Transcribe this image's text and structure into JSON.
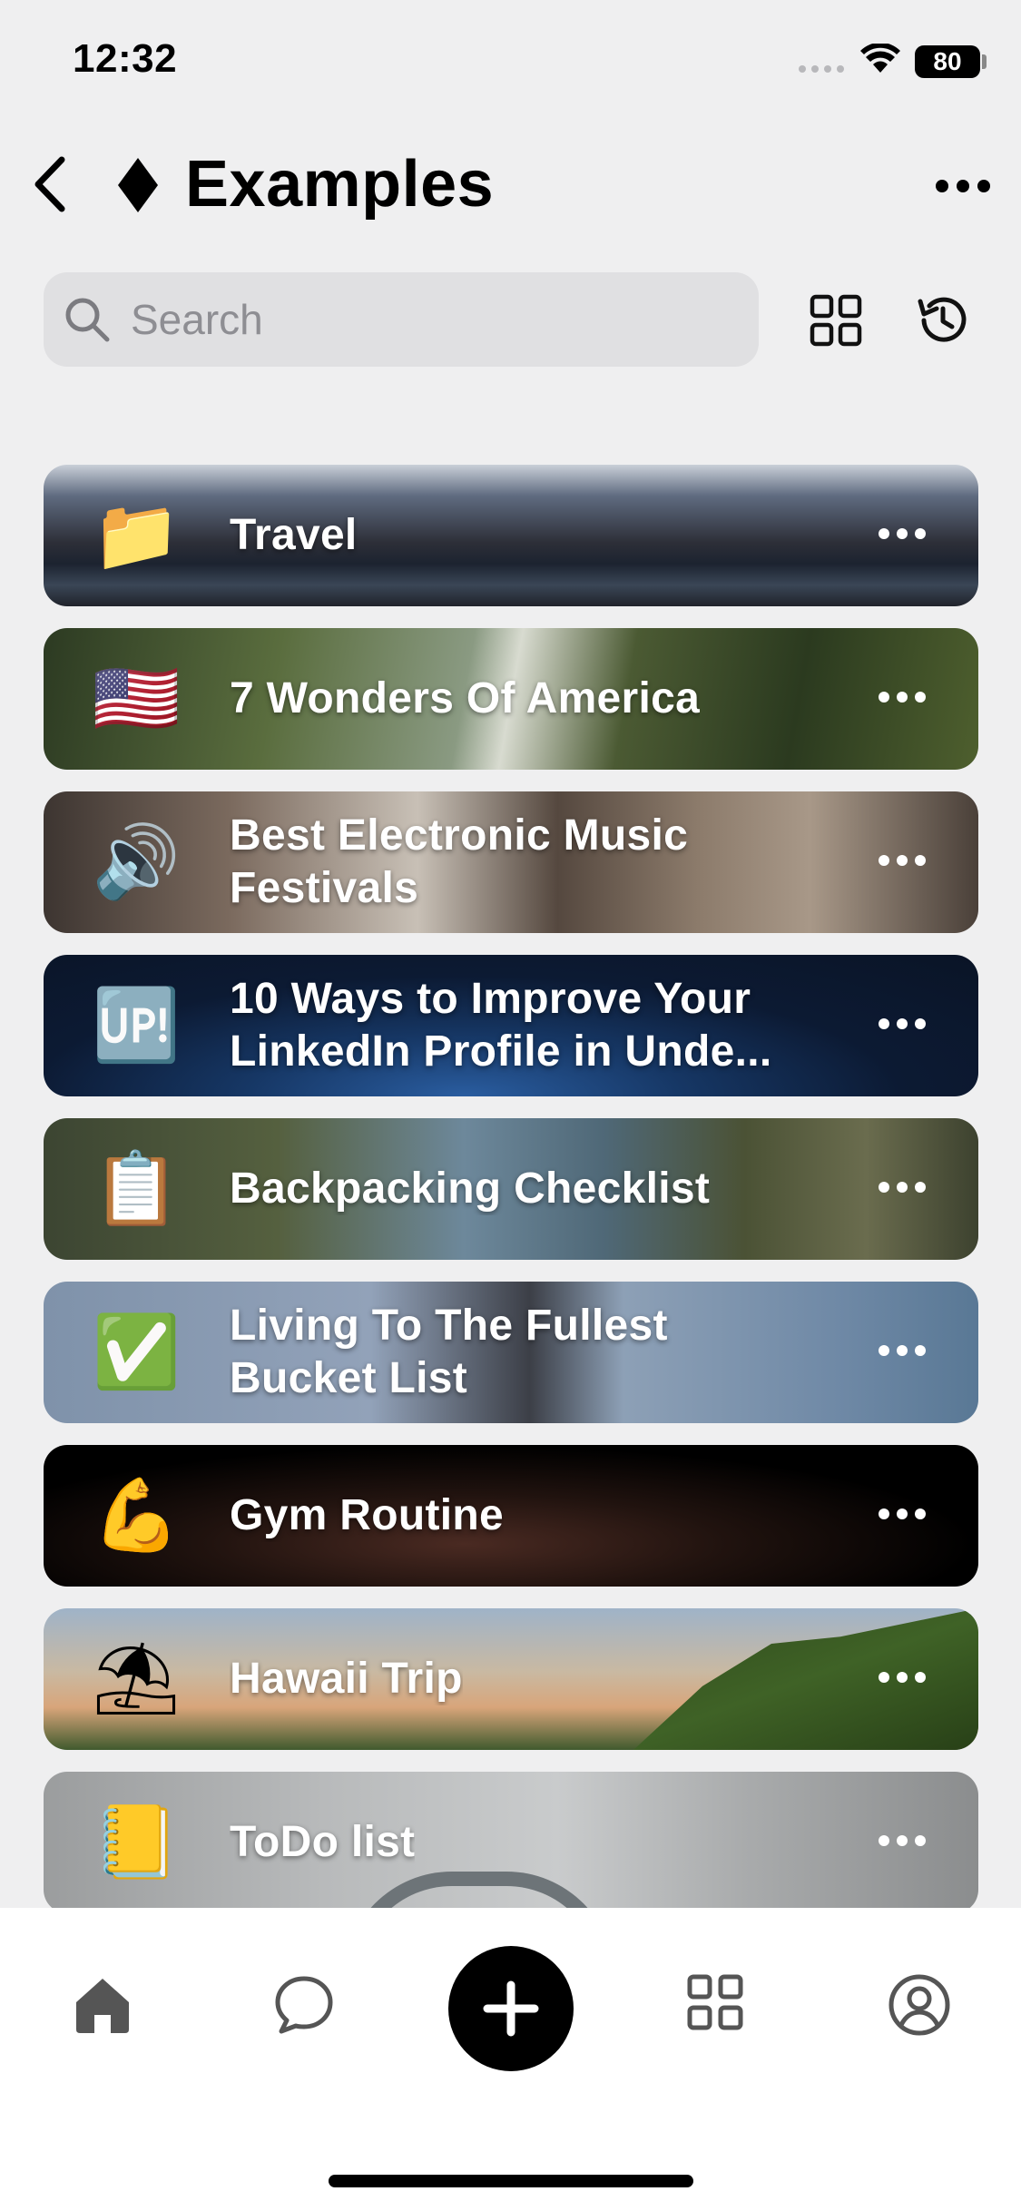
{
  "status_bar": {
    "time": "12:32",
    "battery": "80"
  },
  "header": {
    "title": "Examples"
  },
  "search": {
    "placeholder": "Search"
  },
  "lists": [
    {
      "emoji": "📁",
      "title": "Travel",
      "theme": "travel"
    },
    {
      "emoji": "🇺🇸",
      "title": "7 Wonders Of America",
      "theme": "wonders"
    },
    {
      "emoji": "🔊",
      "title": "Best Electronic Music Festivals",
      "theme": "music"
    },
    {
      "emoji": "🆙",
      "title": "10 Ways to Improve Your LinkedIn Profile in Unde...",
      "theme": "linkedin"
    },
    {
      "emoji": "📋",
      "title": "Backpacking Checklist",
      "theme": "backpack"
    },
    {
      "emoji": "✅",
      "title": "Living To The Fullest Bucket List",
      "theme": "bucket"
    },
    {
      "emoji": "💪",
      "title": "Gym Routine",
      "theme": "gym"
    },
    {
      "emoji": "⛱",
      "title": "Hawaii Trip",
      "theme": "hawaii"
    },
    {
      "emoji": "📒",
      "title": "ToDo list",
      "theme": "todo"
    }
  ],
  "tab_bar": {
    "items": [
      "home-icon",
      "chat-icon",
      "add-icon",
      "grid-icon",
      "profile-icon"
    ]
  }
}
